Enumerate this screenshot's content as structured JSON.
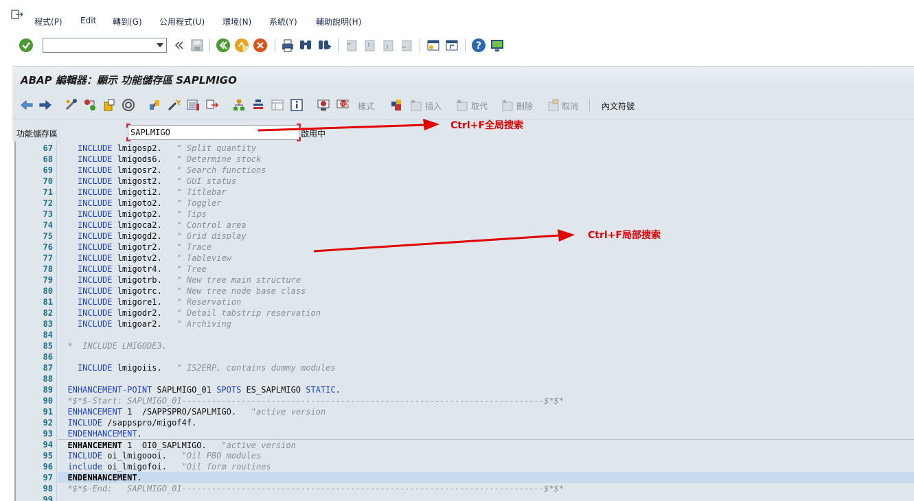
{
  "menu": {
    "items": [
      "程式(P)",
      "Edit",
      "轉到(G)",
      "公用程式(U)",
      "環境(N)",
      "系統(Y)",
      "輔助說明(H)"
    ]
  },
  "toolbar": {
    "command_field_value": ""
  },
  "title": "ABAP 編輯器：顯示 功能儲存區 SAPLMIGO",
  "app_toolbar": {
    "pattern_label": "樣式",
    "insert_label": "插入",
    "replace_label": "取代",
    "delete_label": "刪除",
    "undo_label": "取消",
    "text_symbols_label": "內文符號"
  },
  "field": {
    "label": "功能儲存區",
    "value": "SAPLMIGO",
    "status": "啟用中"
  },
  "annotations": {
    "global_search": "Ctrl+F全局搜索",
    "local_search": "Ctrl+F局部搜索"
  },
  "code_lines": [
    {
      "n": "67",
      "indent": "  ",
      "kw": "INCLUDE",
      "rest": " lmigosp2.",
      "cm": "\" Split quantity"
    },
    {
      "n": "68",
      "indent": "  ",
      "kw": "INCLUDE",
      "rest": " lmigods6.",
      "cm": "\" Determine stock"
    },
    {
      "n": "69",
      "indent": "  ",
      "kw": "INCLUDE",
      "rest": " lmigosr2.",
      "cm": "\" Search functions"
    },
    {
      "n": "70",
      "indent": "  ",
      "kw": "INCLUDE",
      "rest": " lmigost2.",
      "cm": "\" GUI status"
    },
    {
      "n": "71",
      "indent": "  ",
      "kw": "INCLUDE",
      "rest": " lmigoti2.",
      "cm": "\" Titlebar"
    },
    {
      "n": "72",
      "indent": "  ",
      "kw": "INCLUDE",
      "rest": " lmigoto2.",
      "cm": "\" Toggler"
    },
    {
      "n": "73",
      "indent": "  ",
      "kw": "INCLUDE",
      "rest": " lmigotp2.",
      "cm": "\" Tips"
    },
    {
      "n": "74",
      "indent": "  ",
      "kw": "INCLUDE",
      "rest": " lmigoca2.",
      "cm": "\" Control area"
    },
    {
      "n": "75",
      "indent": "  ",
      "kw": "INCLUDE",
      "rest": " lmigogd2.",
      "cm": "\" Grid display"
    },
    {
      "n": "76",
      "indent": "  ",
      "kw": "INCLUDE",
      "rest": " lmigotr2.",
      "cm": "\" Trace"
    },
    {
      "n": "77",
      "indent": "  ",
      "kw": "INCLUDE",
      "rest": " lmigotv2.",
      "cm": "\" Tableview"
    },
    {
      "n": "78",
      "indent": "  ",
      "kw": "INCLUDE",
      "rest": " lmigotr4.",
      "cm": "\" Tree"
    },
    {
      "n": "79",
      "indent": "  ",
      "kw": "INCLUDE",
      "rest": " lmigotrb.",
      "cm": "\" New tree main structure"
    },
    {
      "n": "80",
      "indent": "  ",
      "kw": "INCLUDE",
      "rest": " lmigotrc.",
      "cm": "\" New tree node base class"
    },
    {
      "n": "81",
      "indent": "  ",
      "kw": "INCLUDE",
      "rest": " lmigore1.",
      "cm": "\" Reservation"
    },
    {
      "n": "82",
      "indent": "  ",
      "kw": "INCLUDE",
      "rest": " lmigodr2.",
      "cm": "\" Detail tabstrip reservation"
    },
    {
      "n": "83",
      "indent": "  ",
      "kw": "INCLUDE",
      "rest": " lmigoar2.",
      "cm": "\" Archiving"
    },
    {
      "n": "84",
      "indent": "",
      "kw": "",
      "rest": "",
      "cm": ""
    },
    {
      "n": "85",
      "indent": "",
      "kw": "",
      "rest": "",
      "cm": "*  INCLUDE LMIGODE3."
    },
    {
      "n": "86",
      "indent": "",
      "kw": "",
      "rest": "",
      "cm": ""
    },
    {
      "n": "87",
      "indent": "  ",
      "kw": "INCLUDE",
      "rest": " lmigoiis.",
      "cm": "\" IS2ERP, contains dummy modules"
    },
    {
      "n": "88",
      "indent": "",
      "kw": "",
      "rest": "",
      "cm": ""
    },
    {
      "n": "89",
      "indent": "",
      "kw": "ENHANCEMENT-POINT",
      "rest": " SAPLMIGO_01 ",
      "kw2": "SPOTS",
      "rest2": " ES_SAPLMIGO ",
      "kw3": "STATIC",
      "rest3": "."
    },
    {
      "n": "90",
      "indent": "",
      "kw": "",
      "rest": "",
      "cm": "*$*$-Start: SAPLMIGO_01-------------------------------------------------------------------------$*$*"
    },
    {
      "n": "91",
      "indent": "",
      "kw": "ENHANCEMENT",
      "rest": " 1  /SAPPSPRO/SAPLMIGO.",
      "cm": "\"active version"
    },
    {
      "n": "92",
      "indent": "",
      "kw": "INCLUDE",
      "rest": " /sappspro/migof4f.",
      "cm": ""
    },
    {
      "n": "93",
      "indent": "",
      "kw": "ENDENHANCEMENT",
      "rest": ".",
      "cm": ""
    },
    {
      "n": "94",
      "indent": "",
      "kw": "ENHANCEMENT",
      "rest": " 1  OI0_SAPLMIGO.",
      "cm": "\"active version"
    },
    {
      "n": "95",
      "indent": "",
      "kw": "INCLUDE",
      "rest": " oi_lmigoooi.",
      "cm": "\"Oil PBO modules"
    },
    {
      "n": "96",
      "indent": "",
      "kw": "include",
      "rest": " oi_lmigofoi.",
      "cm": "\"Oil form routines"
    },
    {
      "n": "97",
      "indent": "",
      "kw": "ENDENHANCEMENT",
      "rest": ".",
      "cm": ""
    },
    {
      "n": "98",
      "indent": "",
      "kw": "",
      "rest": "",
      "cm": "*$*$-End:   SAPLMIGO_01-------------------------------------------------------------------------$*$*"
    },
    {
      "n": "99",
      "indent": "",
      "kw": "",
      "rest": "",
      "cm": ""
    }
  ]
}
